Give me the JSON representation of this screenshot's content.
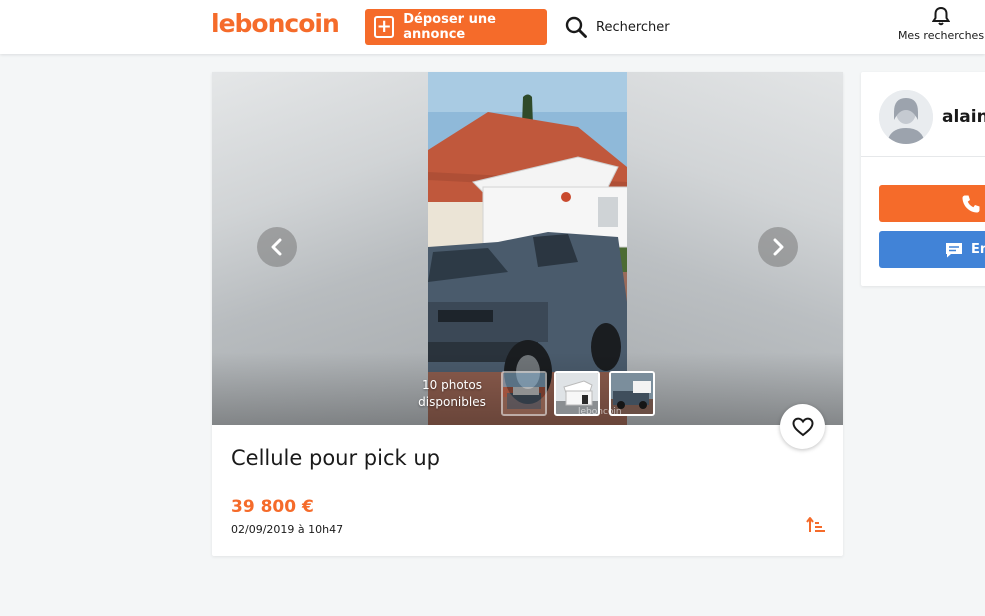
{
  "header": {
    "logo": "leboncoin",
    "post_ad_label": "Déposer une annonce",
    "search_label": "Rechercher",
    "saved_searches_label": "Mes recherches"
  },
  "ad": {
    "title": "Cellule pour pick up",
    "price": "39 800 €",
    "date": "02/09/2019 à 10h47",
    "photo_count_line1": "10 photos",
    "photo_count_line2": "disponibles",
    "watermark": "leboncoin"
  },
  "seller": {
    "name": "alain",
    "message_label": "En"
  },
  "colors": {
    "brand_orange": "#f56b2a",
    "message_blue": "#4183d7"
  },
  "icons": [
    "plus-square-icon",
    "search-icon",
    "bell-icon",
    "chevron-left-icon",
    "chevron-right-icon",
    "heart-icon",
    "sort-icon",
    "phone-icon",
    "chat-icon",
    "avatar-icon"
  ]
}
